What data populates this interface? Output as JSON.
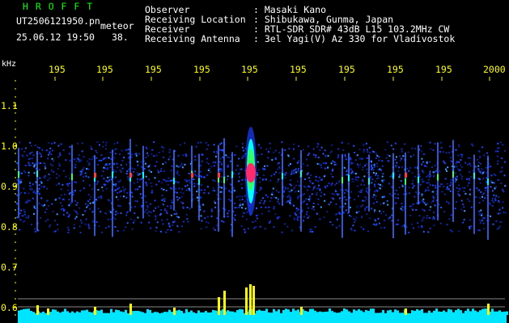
{
  "header": {
    "app_title": "H R O F F T",
    "filename": "UT2506121950.pn",
    "type_label": "meteor",
    "datetime": "25.06.12 19:50",
    "count": "38."
  },
  "info": {
    "labels": [
      "Observer",
      "Receiving Location",
      "Receiver",
      "Receiving Antenna"
    ],
    "values": [
      ": Masaki Kano",
      ": Shibukawa, Gunma, Japan",
      ": RTL-SDR SDR# 43dB L15 103.2MHz CW",
      ": 3el Yagi(V) Az 330 for Vladivostok"
    ]
  },
  "axes": {
    "y_unit": "kHz",
    "y_ticks": [
      "1.1",
      "1.0",
      "0.9",
      "0.8",
      "0.7",
      "0.6"
    ],
    "x_ticks": [
      "195",
      "195",
      "195",
      "195",
      "195",
      "195",
      "195",
      "195",
      "195",
      "2000"
    ]
  },
  "colors": {
    "background": "#000000",
    "text": "#ffffff",
    "title": "#00ff00",
    "axis_labels": "#ffff00",
    "ticks": "#ffff00",
    "baseline_fill": "#00e5ff",
    "signal_peaks": "#ffff00"
  }
}
